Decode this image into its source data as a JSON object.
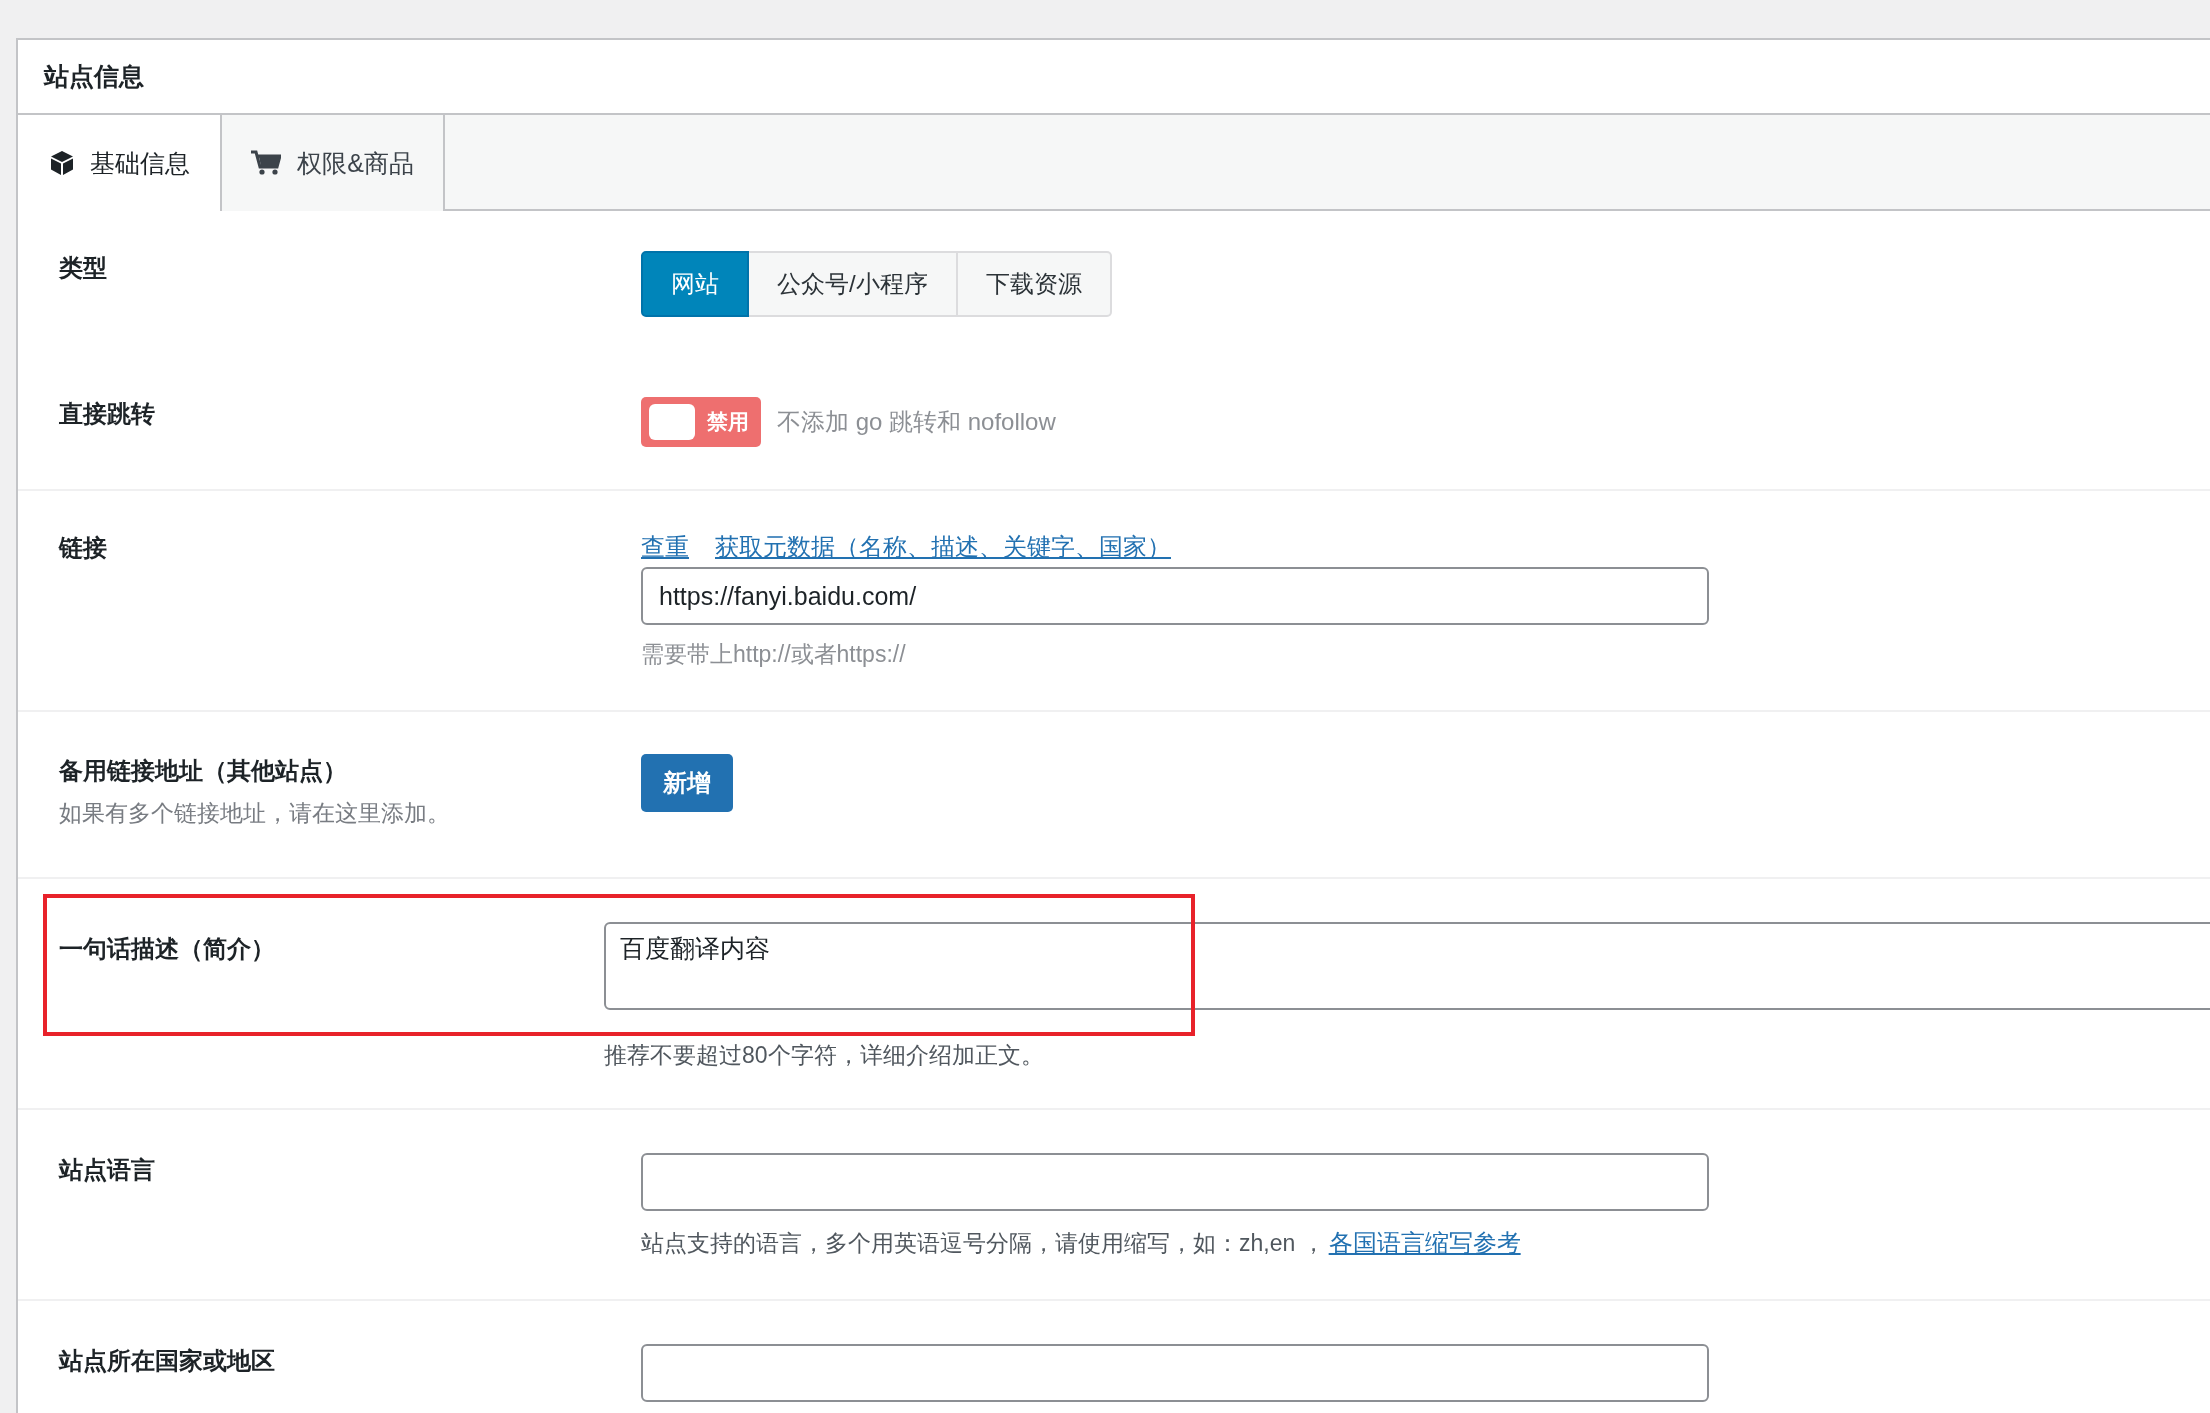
{
  "panel": {
    "title": "站点信息"
  },
  "tabs": [
    {
      "label": "基础信息",
      "selected": true
    },
    {
      "label": "权限&商品",
      "selected": false
    }
  ],
  "fields": [
    {
      "kind": "segmented",
      "divider": false,
      "label": "类型",
      "options": [
        {
          "label": "网站",
          "selected": true
        },
        {
          "label": "公众号/小程序",
          "selected": false
        },
        {
          "label": "下载资源",
          "selected": false
        }
      ]
    },
    {
      "kind": "toggle",
      "label": "直接跳转",
      "on": false,
      "state_label": "禁用",
      "hint": "不添加 go 跳转和 nofollow",
      "divider": false
    },
    {
      "kind": "url",
      "label": "链接",
      "links": [
        "查重",
        "获取元数据（名称、描述、关键字、国家）"
      ],
      "value": "https://fanyi.baidu.com/",
      "help": "需要带上http://或者https://",
      "divider": true
    },
    {
      "kind": "add",
      "label": "备用链接地址（其他站点）",
      "sublabel": "如果有多个链接地址，请在这里添加。",
      "button": "新增",
      "divider": true
    },
    {
      "kind": "textarea",
      "label": "一句话描述（简介）",
      "value": "百度翻译内容",
      "help": "推荐不要超过80个字符，详细介绍加正文。",
      "highlighted": true,
      "divider": true
    },
    {
      "kind": "text",
      "label": "站点语言",
      "help": "站点支持的语言，多个用英语逗号分隔，请使用缩写，如：zh,en ，",
      "help_link": "各国语言缩写参考",
      "divider": true
    },
    {
      "kind": "text",
      "label": "站点所在国家或地区",
      "divider": true
    }
  ]
}
